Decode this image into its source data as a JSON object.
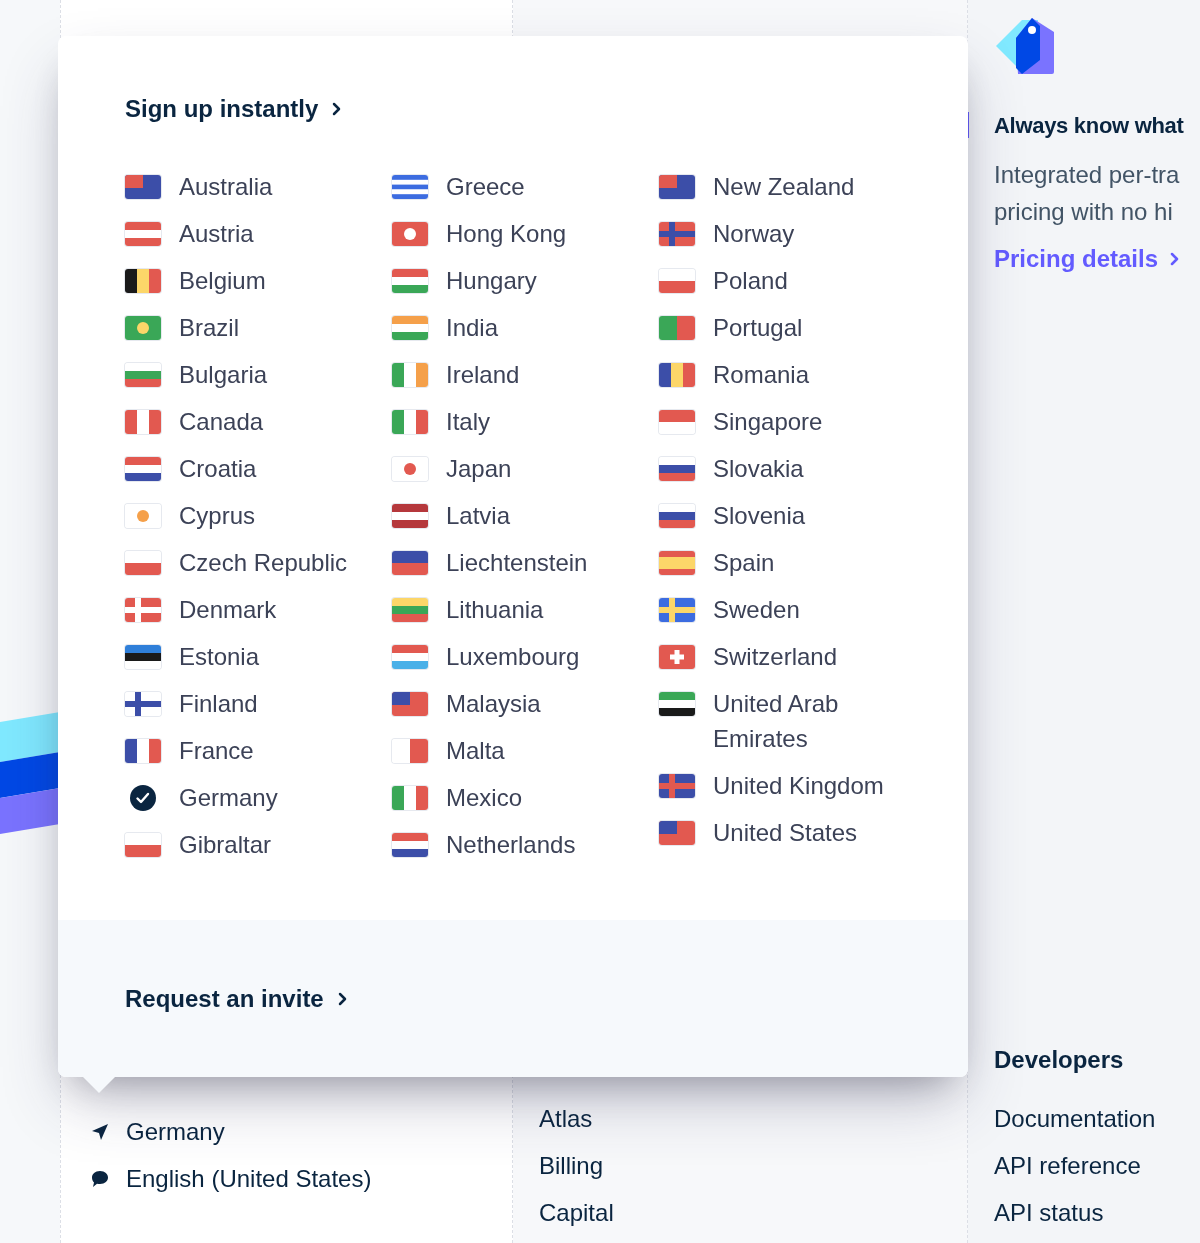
{
  "page": {
    "feature": {
      "title": "Always know what",
      "lines": [
        "Integrated per-tra",
        "pricing with no hi"
      ],
      "link": "Pricing details"
    },
    "locale": [
      {
        "kind": "location",
        "label": "Germany"
      },
      {
        "kind": "language",
        "label": "English (United States)"
      }
    ],
    "products": [
      "Atlas",
      "Billing",
      "Capital"
    ],
    "developers": {
      "title": "Developers",
      "links": [
        "Documentation",
        "API reference",
        "API status"
      ]
    }
  },
  "popup": {
    "sign_up": "Sign up instantly",
    "request": "Request an invite",
    "columns": [
      [
        {
          "name": "Australia",
          "selected": false
        },
        {
          "name": "Austria",
          "selected": false
        },
        {
          "name": "Belgium",
          "selected": false
        },
        {
          "name": "Brazil",
          "selected": false
        },
        {
          "name": "Bulgaria",
          "selected": false
        },
        {
          "name": "Canada",
          "selected": false
        },
        {
          "name": "Croatia",
          "selected": false
        },
        {
          "name": "Cyprus",
          "selected": false
        },
        {
          "name": "Czech Republic",
          "selected": false
        },
        {
          "name": "Denmark",
          "selected": false
        },
        {
          "name": "Estonia",
          "selected": false
        },
        {
          "name": "Finland",
          "selected": false
        },
        {
          "name": "France",
          "selected": false
        },
        {
          "name": "Germany",
          "selected": true
        },
        {
          "name": "Gibraltar",
          "selected": false
        }
      ],
      [
        {
          "name": "Greece",
          "selected": false
        },
        {
          "name": "Hong Kong",
          "selected": false
        },
        {
          "name": "Hungary",
          "selected": false
        },
        {
          "name": "India",
          "selected": false
        },
        {
          "name": "Ireland",
          "selected": false
        },
        {
          "name": "Italy",
          "selected": false
        },
        {
          "name": "Japan",
          "selected": false
        },
        {
          "name": "Latvia",
          "selected": false
        },
        {
          "name": "Liechtenstein",
          "selected": false
        },
        {
          "name": "Lithuania",
          "selected": false
        },
        {
          "name": "Luxembourg",
          "selected": false
        },
        {
          "name": "Malaysia",
          "selected": false
        },
        {
          "name": "Malta",
          "selected": false
        },
        {
          "name": "Mexico",
          "selected": false
        },
        {
          "name": "Netherlands",
          "selected": false
        }
      ],
      [
        {
          "name": "New Zealand",
          "selected": false
        },
        {
          "name": "Norway",
          "selected": false
        },
        {
          "name": "Poland",
          "selected": false
        },
        {
          "name": "Portugal",
          "selected": false
        },
        {
          "name": "Romania",
          "selected": false
        },
        {
          "name": "Singapore",
          "selected": false
        },
        {
          "name": "Slovakia",
          "selected": false
        },
        {
          "name": "Slovenia",
          "selected": false
        },
        {
          "name": "Spain",
          "selected": false
        },
        {
          "name": "Sweden",
          "selected": false
        },
        {
          "name": "Switzerland",
          "selected": false
        },
        {
          "name": "United Arab Emirates",
          "selected": false
        },
        {
          "name": "United Kingdom",
          "selected": false
        },
        {
          "name": "United States",
          "selected": false
        }
      ]
    ]
  }
}
